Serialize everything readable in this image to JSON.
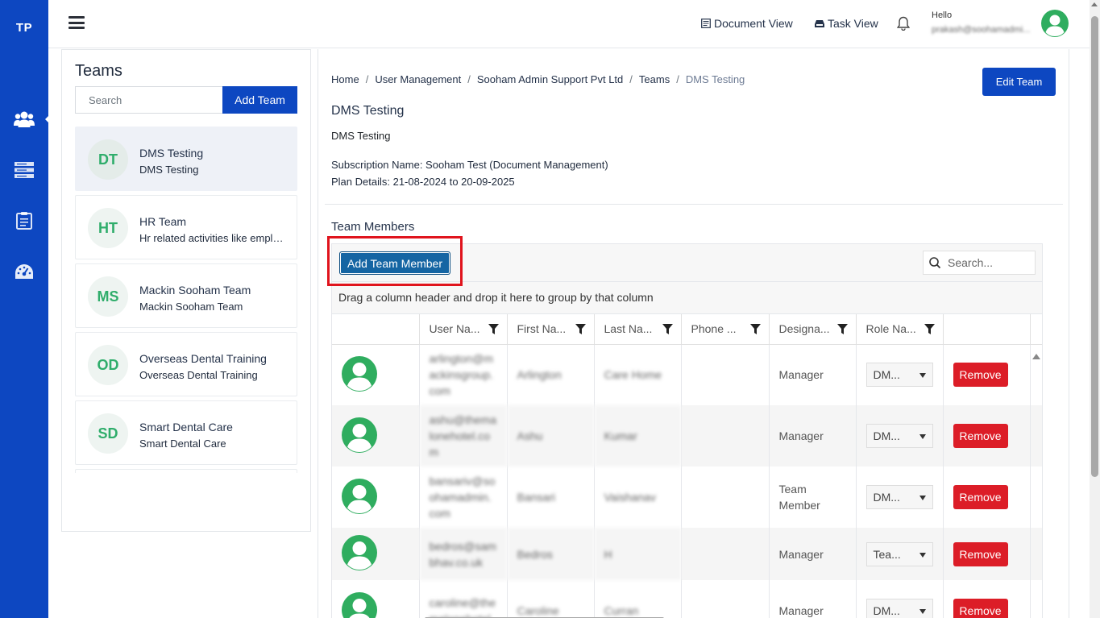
{
  "app": {
    "logo": "TP"
  },
  "topbar": {
    "document_view": "Document View",
    "task_view": "Task View",
    "hello": "Hello",
    "user_email": "prakash@soohamadmi..."
  },
  "sidebar": {
    "title": "Teams",
    "search_placeholder": "Search",
    "add_team_label": "Add Team",
    "teams": [
      {
        "initials": "DT",
        "name": "DMS Testing",
        "description": "DMS Testing"
      },
      {
        "initials": "HT",
        "name": "HR Team",
        "description": "Hr related activities like employee management"
      },
      {
        "initials": "MS",
        "name": "Mackin Sooham Team",
        "description": "Mackin Sooham Team"
      },
      {
        "initials": "OD",
        "name": "Overseas Dental Training",
        "description": "Overseas Dental Training"
      },
      {
        "initials": "SD",
        "name": "Smart Dental Care",
        "description": "Smart Dental Care"
      }
    ]
  },
  "breadcrumb": [
    "Home",
    "User Management",
    "Sooham Admin Support Pvt Ltd",
    "Teams",
    "DMS Testing"
  ],
  "team_detail": {
    "edit_label": "Edit Team",
    "title": "DMS Testing",
    "subtitle": "DMS Testing",
    "subscription": "Subscription Name: Sooham Test (Document Management)",
    "plan": "Plan Details: 21-08-2024 to 20-09-2025",
    "members_title": "Team Members"
  },
  "grid": {
    "add_member_label": "Add Team Member",
    "search_placeholder": "Search...",
    "group_hint": "Drag a column header and drop it here to group by that column",
    "columns": [
      "User Na...",
      "First Na...",
      "Last Na...",
      "Phone ...",
      "Designa...",
      "Role Na..."
    ],
    "remove_label": "Remove",
    "rows": [
      {
        "user": "arlington@mackinsgroup.com",
        "first": "Arlington",
        "last": "Care Home",
        "phone": "",
        "designation": "Manager",
        "role": "DM..."
      },
      {
        "user": "ashu@themalonehotel.com",
        "first": "Ashu",
        "last": "Kumar",
        "phone": "",
        "designation": "Manager",
        "role": "DM..."
      },
      {
        "user": "bansariv@soohamadmin.com",
        "first": "Bansari",
        "last": "Vaishanav",
        "phone": "",
        "designation": "Team Member",
        "role": "DM..."
      },
      {
        "user": "bedros@sambhav.co.uk",
        "first": "Bedros",
        "last": "H",
        "phone": "",
        "designation": "Manager",
        "role": "Tea..."
      },
      {
        "user": "caroline@themalonehotel",
        "first": "Caroline",
        "last": "Curran",
        "phone": "",
        "designation": "Manager",
        "role": "DM..."
      }
    ]
  }
}
